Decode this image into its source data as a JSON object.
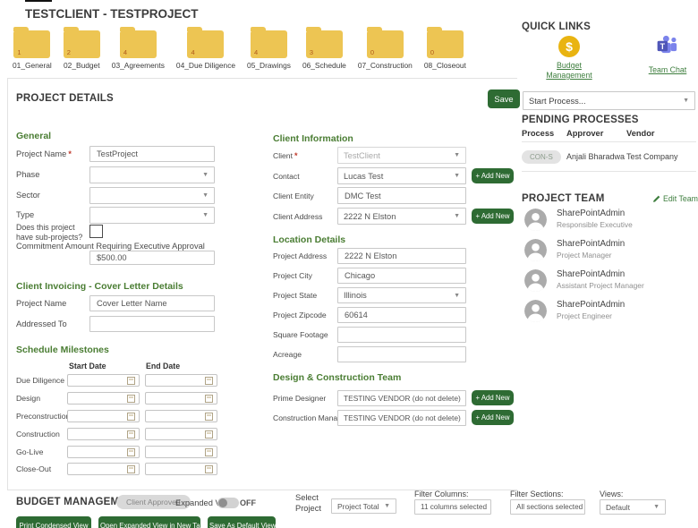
{
  "page_title": "TESTCLIENT - TESTPROJECT",
  "colors": {
    "brand_green": "#2e6b33",
    "heading_green": "#4a7d33",
    "link_green": "#3e7e3e",
    "folder_yellow": "#edc553",
    "required_red": "#c0392b",
    "teams_purple": "#4f56b8",
    "dollar_yellow": "#e9b411"
  },
  "folders": {
    "items": [
      {
        "label": "01_General",
        "count": "1"
      },
      {
        "label": "02_Budget",
        "count": "2"
      },
      {
        "label": "03_Agreements",
        "count": "4"
      },
      {
        "label": "04_Due Diligence",
        "count": "4"
      },
      {
        "label": "05_Drawings",
        "count": "4"
      },
      {
        "label": "06_Schedule",
        "count": "3"
      },
      {
        "label": "07_Construction",
        "count": "0"
      },
      {
        "label": "08_Closeout",
        "count": "0"
      }
    ]
  },
  "quick_links": {
    "title": "QUICK LINKS",
    "items": [
      {
        "label": "Budget Management",
        "icon": "dollar-circle-icon"
      },
      {
        "label": "Team Chat",
        "icon": "teams-icon"
      }
    ]
  },
  "project_details": {
    "title": "PROJECT DETAILS",
    "save_label": "Save"
  },
  "start_process": {
    "value": "Start Process..."
  },
  "pending_processes": {
    "title": "PENDING PROCESSES",
    "columns": [
      "Process",
      "Approver",
      "Vendor"
    ],
    "rows": [
      {
        "process": "CON-S",
        "approver": "Anjali Bharadwa",
        "vendor": "Test Company"
      }
    ]
  },
  "project_team": {
    "title": "PROJECT TEAM",
    "edit_label": "Edit Team",
    "members": [
      {
        "name": "SharePointAdmin",
        "role": "Responsible Executive"
      },
      {
        "name": "SharePointAdmin",
        "role": "Project Manager"
      },
      {
        "name": "SharePointAdmin",
        "role": "Assistant Project Manager"
      },
      {
        "name": "SharePointAdmin",
        "role": "Project Engineer"
      }
    ]
  },
  "general": {
    "title": "General",
    "project_name": {
      "label": "Project Name",
      "required": "*",
      "value": "TestProject"
    },
    "phase": {
      "label": "Phase",
      "value": ""
    },
    "sector": {
      "label": "Sector",
      "value": ""
    },
    "type": {
      "label": "Type",
      "value": ""
    },
    "subprojects": {
      "label": "Does this project have sub-projects?"
    },
    "commitment": {
      "label": "Commitment Amount Requiring Executive Approval",
      "value": "$500.00"
    }
  },
  "client_invoicing": {
    "title": "Client Invoicing - Cover Letter Details",
    "project_name": {
      "label": "Project Name",
      "value": "Cover Letter Name"
    },
    "addressed_to": {
      "label": "Addressed To",
      "value": ""
    }
  },
  "schedule_milestones": {
    "title": "Schedule Milestones",
    "columns": [
      "Start Date",
      "End Date"
    ],
    "rows": [
      {
        "label": "Due Diligence"
      },
      {
        "label": "Design"
      },
      {
        "label": "Preconstruction"
      },
      {
        "label": "Construction"
      },
      {
        "label": "Go-Live"
      },
      {
        "label": "Close-Out"
      }
    ]
  },
  "client_information": {
    "title": "Client Information",
    "client": {
      "label": "Client",
      "required": "*",
      "value": "TestClient"
    },
    "contact": {
      "label": "Contact",
      "value": "Lucas Test",
      "add_label": "+ Add New"
    },
    "client_entity": {
      "label": "Client Entity",
      "value": "DMC Test"
    },
    "client_address": {
      "label": "Client Address",
      "value": "2222 N Elston",
      "add_label": "+ Add New"
    }
  },
  "location_details": {
    "title": "Location Details",
    "project_address": {
      "label": "Project Address",
      "value": "2222 N Elston"
    },
    "project_city": {
      "label": "Project City",
      "value": "Chicago"
    },
    "project_state": {
      "label": "Project State",
      "value": "Illinois"
    },
    "project_zipcode": {
      "label": "Project Zipcode",
      "value": "60614"
    },
    "square_footage": {
      "label": "Square Footage",
      "value": ""
    },
    "acreage": {
      "label": "Acreage",
      "value": ""
    }
  },
  "design_construction": {
    "title": "Design & Construction Team",
    "prime_designer": {
      "label": "Prime Designer",
      "value": "TESTING VENDOR (do not delete)",
      "add_label": "+ Add New"
    },
    "construction_manager": {
      "label": "Construction Manager",
      "value": "TESTING VENDOR (do not delete)",
      "add_label": "+ Add New"
    }
  },
  "budget_management": {
    "title": "BUDGET MANAGEMENT",
    "status_badge": "Client Approved",
    "expanded_view_label": "Expanded View",
    "toggle_state": "OFF",
    "select_project_label": "Select Project",
    "select_project_value": "Project Total",
    "filter_columns_label": "Filter Columns:",
    "filter_columns_value": "11 columns selected",
    "filter_sections_label": "Filter Sections:",
    "filter_sections_value": "All sections selected",
    "views_label": "Views:",
    "views_value": "Default",
    "buttons": [
      "Print Condensed View",
      "Open Expanded View in New Tab",
      "Save As Default View"
    ]
  }
}
